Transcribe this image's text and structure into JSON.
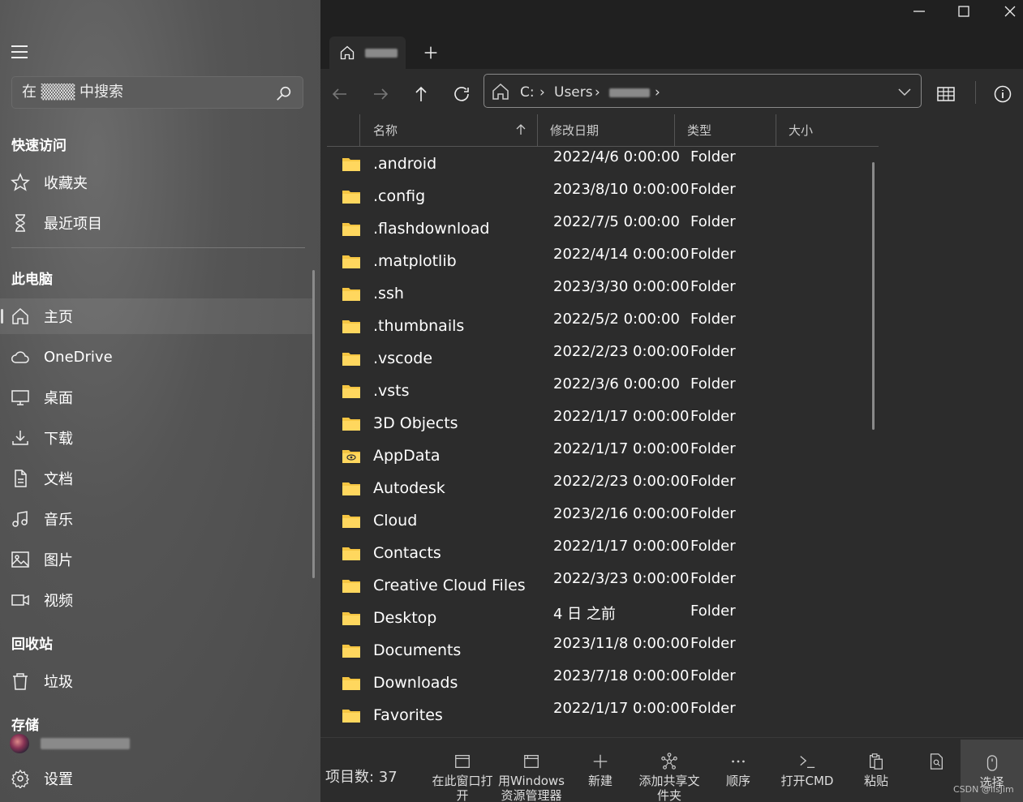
{
  "sidebar": {
    "search_placeholder": "在 ▒▒▒ 中搜索",
    "quick_access_header": "快速访问",
    "quick_access": [
      {
        "label": "收藏夹",
        "icon": "star-icon"
      },
      {
        "label": "最近项目",
        "icon": "hourglass-icon"
      }
    ],
    "this_pc_header": "此电脑",
    "this_pc": [
      {
        "label": "主页",
        "icon": "home-icon"
      },
      {
        "label": "OneDrive",
        "icon": "cloud-icon"
      },
      {
        "label": "桌面",
        "icon": "desktop-icon"
      },
      {
        "label": "下载",
        "icon": "download-icon"
      },
      {
        "label": "文档",
        "icon": "document-icon"
      },
      {
        "label": "音乐",
        "icon": "music-icon"
      },
      {
        "label": "图片",
        "icon": "picture-icon"
      },
      {
        "label": "视频",
        "icon": "video-icon"
      }
    ],
    "recycle_header": "回收站",
    "recycle": [
      {
        "label": "垃圾",
        "icon": "trash-icon"
      }
    ],
    "storage_header": "存储",
    "settings_label": "设置"
  },
  "address": {
    "segments": [
      "C:",
      "›",
      "Users",
      "›",
      "›"
    ]
  },
  "columns": {
    "name": "名称",
    "modified": "修改日期",
    "type": "类型",
    "size": "大小"
  },
  "files": [
    {
      "name": ".android",
      "date": "2022/4/6 0:00:00",
      "type": "Folder"
    },
    {
      "name": ".config",
      "date": "2023/8/10 0:00:00",
      "type": "Folder"
    },
    {
      "name": ".flashdownload",
      "date": "2022/7/5 0:00:00",
      "type": "Folder"
    },
    {
      "name": ".matplotlib",
      "date": "2022/4/14 0:00:00",
      "type": "Folder"
    },
    {
      "name": ".ssh",
      "date": "2023/3/30 0:00:00",
      "type": "Folder"
    },
    {
      "name": ".thumbnails",
      "date": "2022/5/2 0:00:00",
      "type": "Folder"
    },
    {
      "name": ".vscode",
      "date": "2022/2/23 0:00:00",
      "type": "Folder"
    },
    {
      "name": ".vsts",
      "date": "2022/3/6 0:00:00",
      "type": "Folder"
    },
    {
      "name": "3D Objects",
      "date": "2022/1/17 0:00:00",
      "type": "Folder"
    },
    {
      "name": "AppData",
      "date": "2022/1/17 0:00:00",
      "type": "Folder"
    },
    {
      "name": "Autodesk",
      "date": "2022/2/23 0:00:00",
      "type": "Folder"
    },
    {
      "name": "Cloud",
      "date": "2023/2/16 0:00:00",
      "type": "Folder"
    },
    {
      "name": "Contacts",
      "date": "2022/1/17 0:00:00",
      "type": "Folder"
    },
    {
      "name": "Creative Cloud Files",
      "date": "2022/3/23 0:00:00",
      "type": "Folder"
    },
    {
      "name": "Desktop",
      "date": "4 日 之前",
      "type": "Folder"
    },
    {
      "name": "Documents",
      "date": "2023/11/8 0:00:00",
      "type": "Folder"
    },
    {
      "name": "Downloads",
      "date": "2023/7/18 0:00:00",
      "type": "Folder"
    },
    {
      "name": "Favorites",
      "date": "2022/1/17 0:00:00",
      "type": "Folder"
    }
  ],
  "status": {
    "item_count": "项目数: 37"
  },
  "commands": [
    {
      "label": "在此窗口打开",
      "icon": "window-icon"
    },
    {
      "label": "用Windows资源管理器",
      "icon": "explorer-icon"
    },
    {
      "label": "新建",
      "icon": "plus-icon"
    },
    {
      "label": "添加共享文件夹",
      "icon": "share-icon"
    },
    {
      "label": "顺序",
      "icon": "more-icon"
    },
    {
      "label": "打开CMD",
      "icon": "terminal-icon"
    },
    {
      "label": "粘贴",
      "icon": "paste-icon"
    },
    {
      "label": "",
      "icon": "preview-icon"
    },
    {
      "label": "选择",
      "icon": "mouse-icon"
    }
  ],
  "watermark": "CSDN @lisJim",
  "colors": {
    "folder": "#f5c542",
    "sidebar_bg": "#555555",
    "content_bg": "#2c2c2c"
  }
}
